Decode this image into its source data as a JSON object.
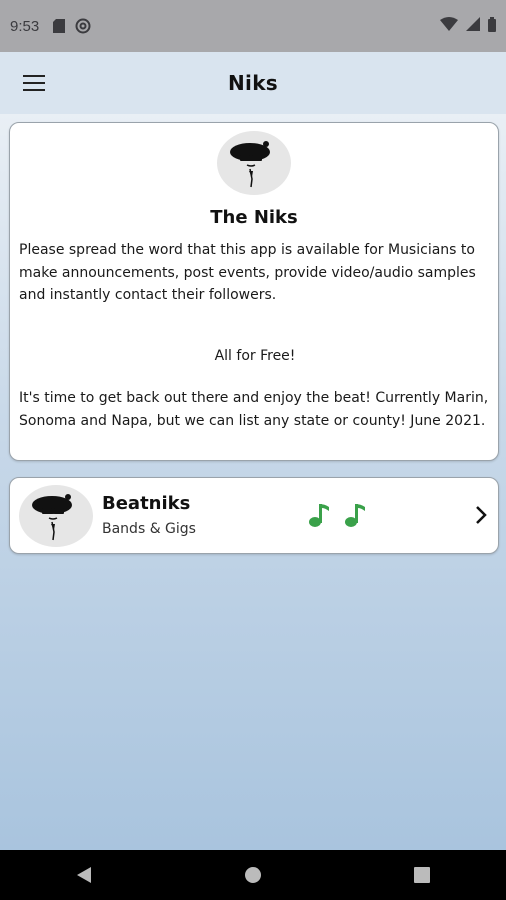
{
  "status_bar": {
    "time": "9:53",
    "left_icons": [
      "sd-card-icon",
      "at-sign-icon"
    ],
    "right_icons": [
      "wifi-icon",
      "signal-icon",
      "battery-icon"
    ]
  },
  "app_bar": {
    "title": "Niks",
    "menu_icon": "hamburger-menu-icon"
  },
  "info_card": {
    "title": "The Niks",
    "paragraph1": "Please spread the word that this app is available for Musicians to make announcements, post events, provide video/audio samples and instantly contact their followers.",
    "paragraph2": "All for Free!",
    "paragraph3": "It's time to get back out there and enjoy the beat! Currently Marin, Sonoma and Napa, but we can list any state or county!  June 2021."
  },
  "list": {
    "items": [
      {
        "name": "Beatniks",
        "subtitle": "Bands & Gigs",
        "note_color": "#3aa14a",
        "trailing_icon": "chevron-right-icon"
      }
    ]
  },
  "nav_bar": {
    "buttons": [
      "back-icon",
      "home-icon",
      "recents-icon"
    ]
  }
}
